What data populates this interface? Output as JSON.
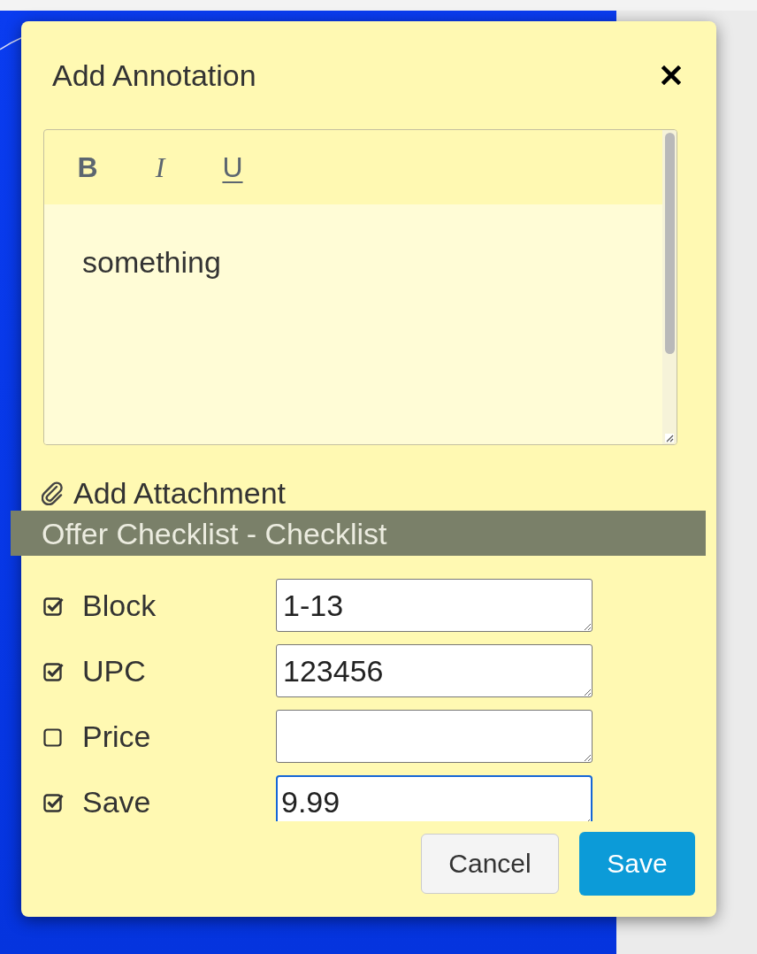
{
  "dialog": {
    "title": "Add Annotation"
  },
  "editor": {
    "toolbar": [
      {
        "label": "B",
        "kind": "bold"
      },
      {
        "label": "I",
        "kind": "italic"
      },
      {
        "label": "U",
        "kind": "underline"
      }
    ],
    "text": "something"
  },
  "attachment": {
    "label": "Add Attachment"
  },
  "checklist": {
    "title": "Offer Checklist - Checklist",
    "items": [
      {
        "label": "Block",
        "checked": true,
        "value": "1-13",
        "focused": false
      },
      {
        "label": "UPC",
        "checked": true,
        "value": "123456",
        "focused": false
      },
      {
        "label": "Price",
        "checked": false,
        "focused": false
      },
      {
        "label": "Save",
        "checked": true,
        "value": "9.99",
        "focused": true
      }
    ]
  },
  "buttons": [
    {
      "label": "Cancel",
      "kind": "secondary"
    },
    {
      "label": "Save",
      "kind": "primary"
    }
  ]
}
